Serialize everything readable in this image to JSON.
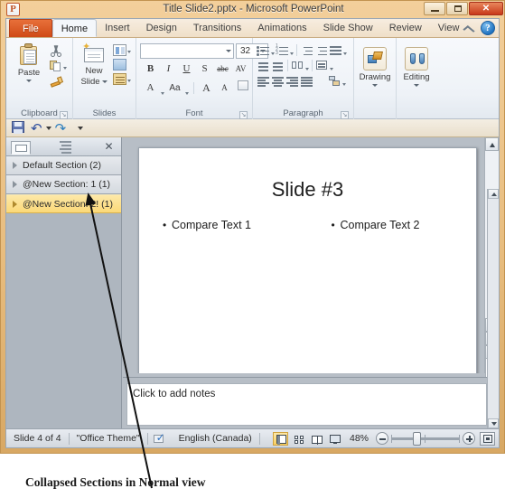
{
  "window": {
    "title": "Title Slide2.pptx  -  Microsoft PowerPoint",
    "app_icon": "P",
    "minimize_label": "Minimize",
    "restore_label": "Restore",
    "close_label": "✕"
  },
  "ribbon": {
    "tabs": [
      {
        "label": "File",
        "id": "file"
      },
      {
        "label": "Home",
        "id": "home"
      },
      {
        "label": "Insert",
        "id": "insert"
      },
      {
        "label": "Design",
        "id": "design"
      },
      {
        "label": "Transitions",
        "id": "transitions"
      },
      {
        "label": "Animations",
        "id": "animations"
      },
      {
        "label": "Slide Show",
        "id": "slide-show"
      },
      {
        "label": "Review",
        "id": "review"
      },
      {
        "label": "View",
        "id": "view"
      }
    ],
    "active_tab": "Home",
    "minimize_ribbon_icon": "chevron-up-icon",
    "help_label": "?",
    "groups": {
      "clipboard": {
        "label": "Clipboard",
        "paste_label": "Paste",
        "cut_icon": "scissors-icon",
        "copy_icon": "copy-icon",
        "format_painter_icon": "format-painter-icon",
        "launcher": "↘"
      },
      "slides": {
        "label": "Slides",
        "new_slide_label": "New\nSlide",
        "new_slide_line1": "New",
        "new_slide_line2": "Slide",
        "layout_icon": "layout-icon",
        "reset_icon": "reset-icon",
        "section_icon": "section-icon"
      },
      "font": {
        "label": "Font",
        "font_name_value": "",
        "font_size_value": "32",
        "bold": "B",
        "italic": "I",
        "underline": "U",
        "shadow": "S",
        "strikethrough": "abc",
        "char_spacing": "AV",
        "font_color": "A",
        "change_case": "Aa",
        "grow_font": "A",
        "shrink_font": "A",
        "clear_formatting": "clear-formatting-icon",
        "launcher": "↘"
      },
      "paragraph": {
        "label": "Paragraph",
        "bullets_icon": "bullets-icon",
        "numbering_icon": "numbering-icon",
        "line_spacing_icon": "line-spacing-icon",
        "text_direction_icon": "text-direction-icon",
        "decrease_indent_icon": "decrease-indent-icon",
        "increase_indent_icon": "increase-indent-icon",
        "columns_icon": "columns-icon",
        "align_text_icon": "align-text-icon",
        "align_left_icon": "align-left-icon",
        "align_center_icon": "align-center-icon",
        "align_right_icon": "align-right-icon",
        "justify_icon": "justify-icon",
        "smartart_icon": "convert-to-smartart-icon",
        "launcher": "↘"
      },
      "drawing": {
        "label": "Drawing",
        "icon": "shapes-icon"
      },
      "editing": {
        "label": "Editing",
        "icon": "binoculars-icon"
      }
    }
  },
  "quick_access": {
    "save_icon": "save-icon",
    "undo_icon": "undo-icon",
    "redo_icon": "redo-icon",
    "customize_icon": "customize-qat-icon"
  },
  "left_panel": {
    "slides_tab_icon": "slides-tab-icon",
    "outline_tab_icon": "outline-tab-icon",
    "close_label": "✕",
    "sections": [
      {
        "label": "Default Section (2)",
        "selected": false
      },
      {
        "label": "@New Section: 1 (1)",
        "selected": false
      },
      {
        "label": "@New Section: 2! (1)",
        "selected": true
      }
    ]
  },
  "slide": {
    "title": "Slide #3",
    "bullet_glyph": "•",
    "left_text": "Compare Text 1",
    "right_text": "Compare Text 2"
  },
  "notes": {
    "placeholder": "Click to add notes"
  },
  "status_bar": {
    "slide_counter": "Slide 4 of 4",
    "theme": "\"Office Theme\"",
    "spellcheck_icon": "spellcheck-icon",
    "language": "English (Canada)",
    "views": [
      {
        "name": "normal-view",
        "label": "Normal",
        "active": true
      },
      {
        "name": "slide-sorter-view",
        "label": "Slide Sorter",
        "active": false
      },
      {
        "name": "reading-view",
        "label": "Reading View",
        "active": false
      },
      {
        "name": "slide-show-view",
        "label": "Slide Show",
        "active": false
      }
    ],
    "zoom_level": "48%",
    "zoom_out_label": "−",
    "zoom_in_label": "+",
    "fit_to_window_label": "Fit slide to current window"
  },
  "annotation": {
    "caption": "Collapsed Sections in Normal view",
    "arrow": "callout-arrow"
  },
  "colors": {
    "window_frame": "#e8bd7f",
    "file_tab": "#cf4a16",
    "selected_section": "#fbd978",
    "workspace": "#b7bec6",
    "slide_white": "#ffffff"
  }
}
